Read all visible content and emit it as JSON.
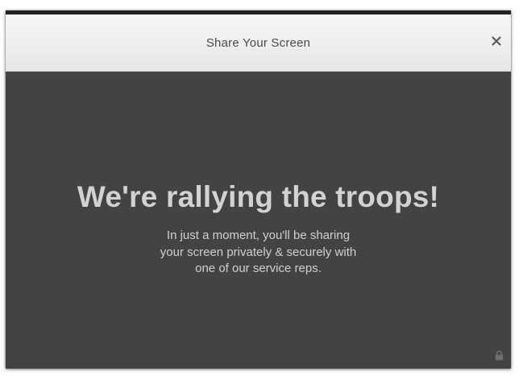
{
  "dialog": {
    "title": "Share Your Screen",
    "close_icon": "close-icon",
    "headline": "We're rallying the troops!",
    "message_lines": [
      "In just a moment, you'll be sharing",
      "your screen privately & securely with",
      "one of our service reps."
    ],
    "footer_icon": "lock-icon"
  },
  "colors": {
    "body_bg": "#434343",
    "header_bg": "#eeeeee",
    "headline_text": "#d2d2d2",
    "title_text": "#4a4a4a"
  }
}
